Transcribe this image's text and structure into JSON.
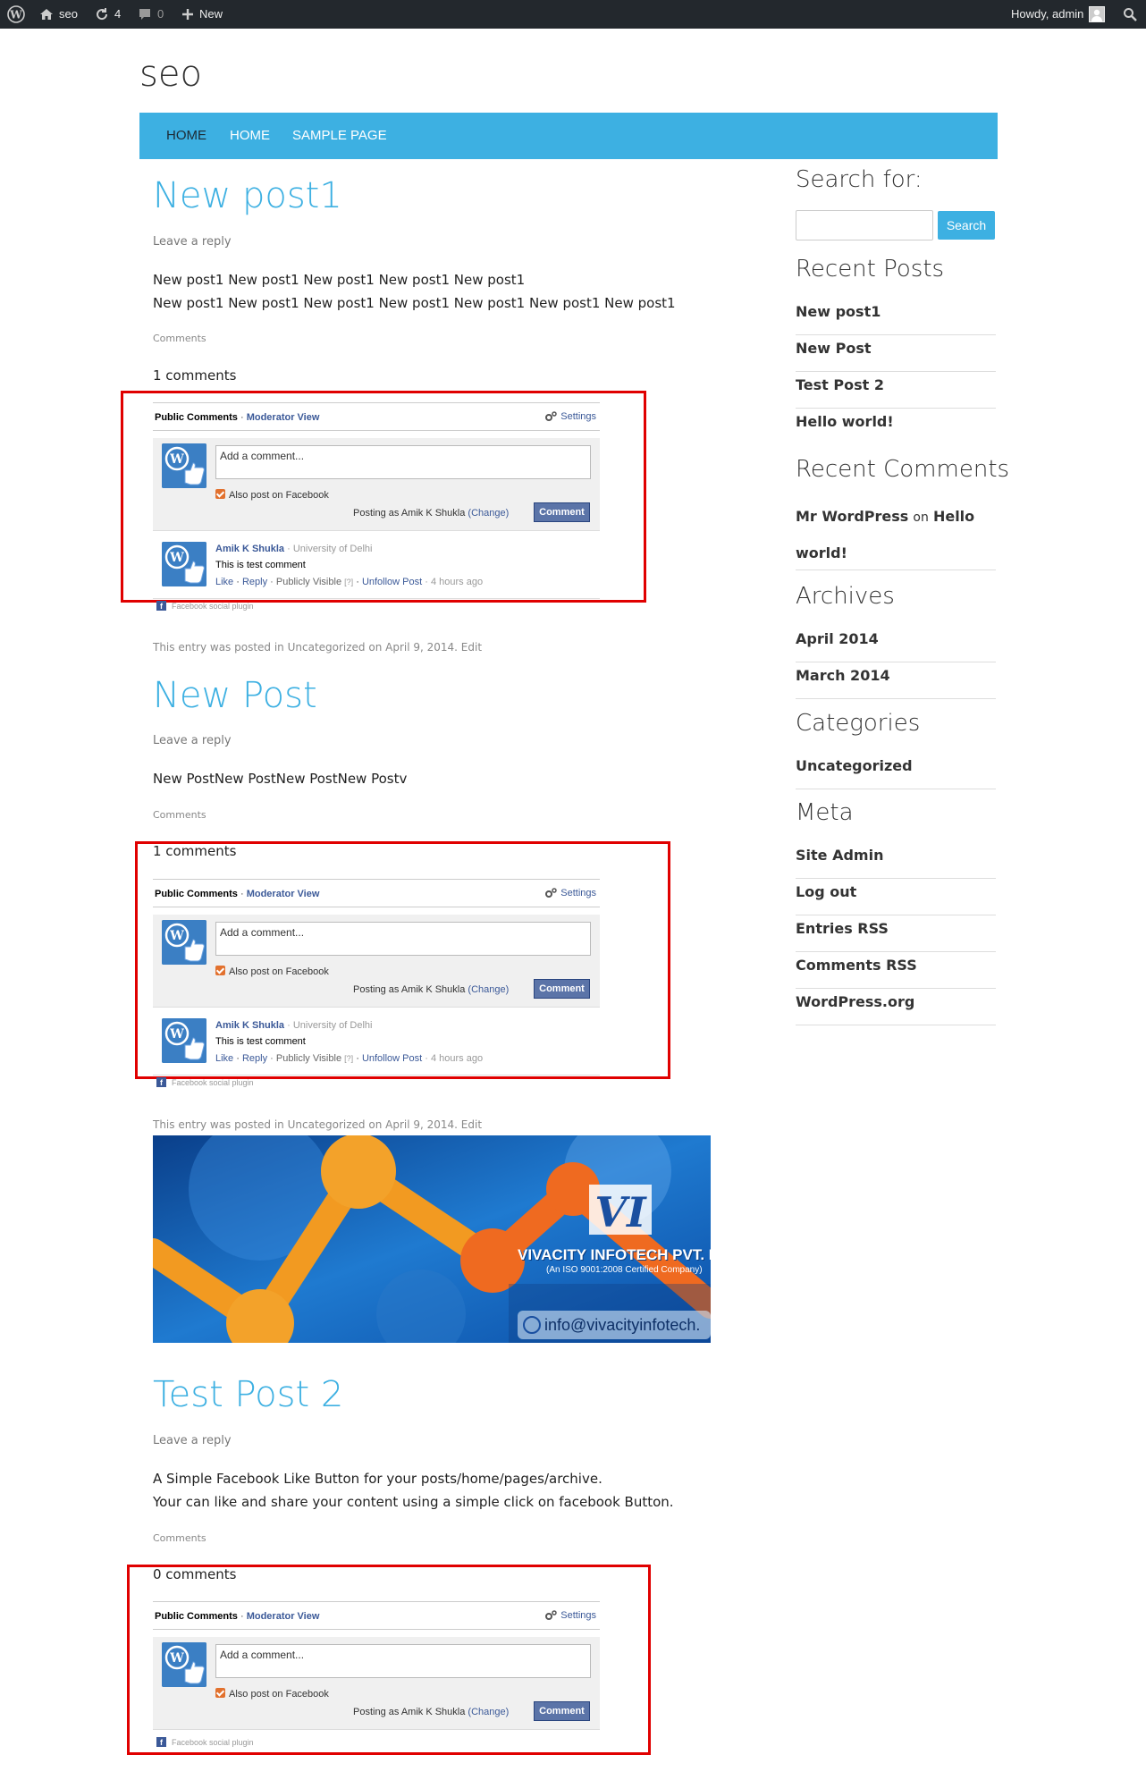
{
  "admin_bar": {
    "site_name": "seo",
    "updates_count": "4",
    "comments_count": "0",
    "new_label": "New",
    "howdy": "Howdy, admin"
  },
  "site": {
    "title": "seo"
  },
  "nav": {
    "items": [
      "HOME",
      "HOME",
      "SAMPLE PAGE"
    ]
  },
  "posts": [
    {
      "title": "New post1",
      "leave_reply": "Leave a reply",
      "body_lines": [
        "New post1 New post1 New post1 New post1 New post1",
        "New post1 New post1 New post1 New post1 New post1 New post1 New post1"
      ],
      "comments_link": "Comments",
      "comments_count": "1 comments",
      "footer": "This entry was posted in Uncategorized on April 9, 2014. Edit"
    },
    {
      "title": "New Post",
      "leave_reply": "Leave a reply",
      "body_lines": [
        "New PostNew PostNew PostNew Postv"
      ],
      "comments_link": "Comments",
      "comments_count": "1 comments",
      "footer": "This entry was posted in Uncategorized on April 9, 2014. Edit",
      "banner": {
        "company": "VIVACITY INFOTECH PVT. L",
        "iso": "(An ISO 9001:2008 Certified Company)",
        "email": "info@vivacityinfotech."
      }
    },
    {
      "title": "Test Post 2",
      "leave_reply": "Leave a reply",
      "body_lines": [
        "A Simple Facebook Like Button for your posts/home/pages/archive.",
        "Your can like and share your content using a simple click on facebook Button."
      ],
      "comments_link": "Comments",
      "comments_count": "0 comments"
    }
  ],
  "fb_widget": {
    "public_comments": "Public Comments",
    "sep": "·",
    "moderator_view": "Moderator View",
    "settings": "Settings",
    "placeholder": "Add a comment...",
    "also_post": "Also post on Facebook",
    "posting_as": "Posting as Amik K Shukla",
    "change": "(Change)",
    "comment_btn": "Comment",
    "social_plugin": "Facebook social plugin",
    "comment": {
      "author": "Amik K Shukla",
      "affiliation": "· University of Delhi",
      "text": "This is test comment",
      "like": "Like",
      "reply": "Reply",
      "visibility": "· Publicly Visible",
      "help": "[?]",
      "unfollow": "Unfollow Post",
      "time": "· 4 hours ago"
    }
  },
  "sidebar": {
    "search_heading": "Search for:",
    "search_button": "Search",
    "recent_posts_heading": "Recent Posts",
    "recent_posts": [
      "New post1",
      "New Post",
      "Test Post 2",
      "Hello world!"
    ],
    "recent_comments_heading": "Recent Comments",
    "recent_comment": {
      "author": "Mr WordPress",
      "on": "on",
      "post_a": "Hello",
      "post_b": "world!"
    },
    "archives_heading": "Archives",
    "archives": [
      "April 2014",
      "March 2014"
    ],
    "categories_heading": "Categories",
    "categories": [
      "Uncategorized"
    ],
    "meta_heading": "Meta",
    "meta": [
      "Site Admin",
      "Log out",
      "Entries RSS",
      "Comments RSS",
      "WordPress.org"
    ]
  },
  "colors": {
    "accent": "#3db0e2",
    "admin_bar": "#23282d",
    "highlight_box": "#e00000",
    "fb_blue": "#3b5998"
  }
}
